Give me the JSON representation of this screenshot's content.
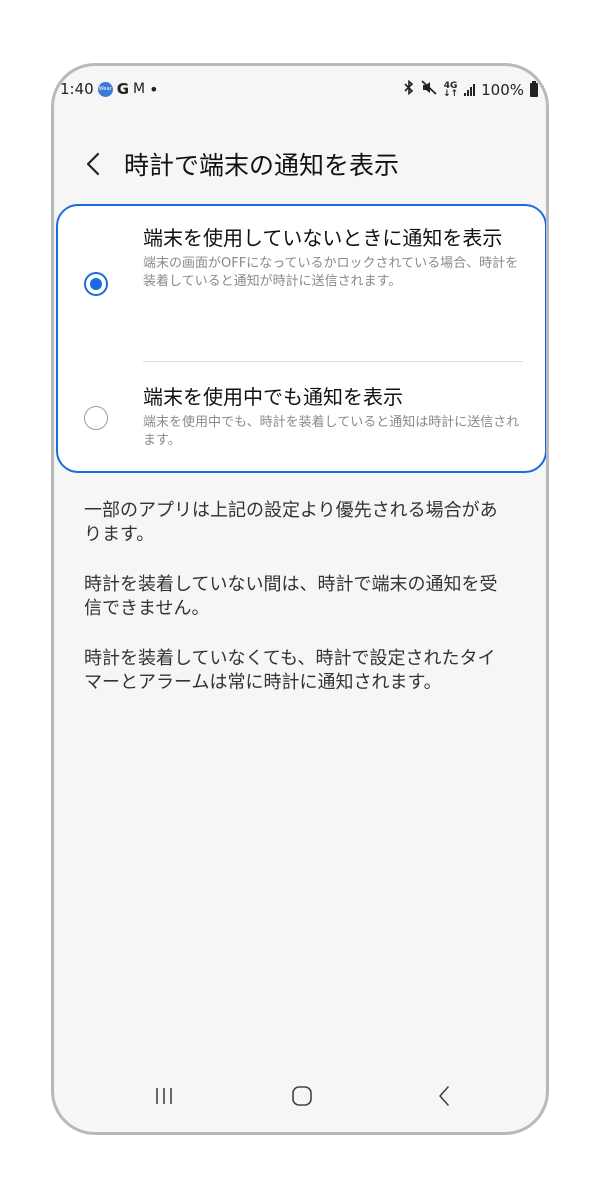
{
  "status_bar": {
    "time": "1:40",
    "wear_badge": "Wear",
    "gmail_icon_glyph": "M",
    "battery": "100%"
  },
  "header": {
    "title": "時計で端末の通知を表示"
  },
  "options": [
    {
      "title": "端末を使用していないときに通知を表示",
      "description": "端末の画面がOFFになっているかロックされている場合、時計を装着していると通知が時計に送信されます。",
      "selected": true
    },
    {
      "title": "端末を使用中でも通知を表示",
      "description": "端末を使用中でも、時計を装着していると通知は時計に送信されます。",
      "selected": false
    }
  ],
  "notes": [
    "一部のアプリは上記の設定より優先される場合があります。",
    "時計を装着していない間は、時計で端末の通知を受信できません。",
    "時計を装着していなくても、時計で設定されたタイマーとアラームは常に時計に通知されます。"
  ],
  "colors": {
    "accent": "#1d6ae0",
    "background": "#f6f6f6",
    "card": "#ffffff",
    "secondary_text": "#8a8a8a"
  },
  "icons": {
    "back": "back-arrow-icon",
    "recents": "recents-icon",
    "home": "home-icon",
    "nav_back": "nav-back-icon"
  }
}
